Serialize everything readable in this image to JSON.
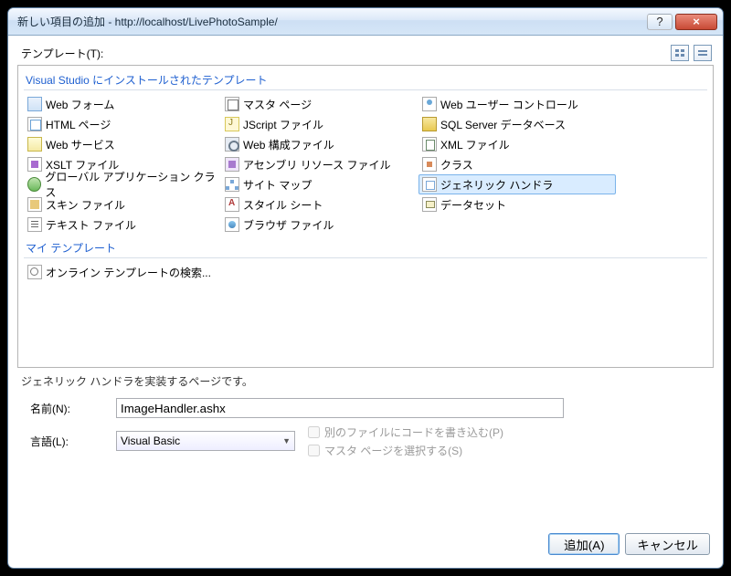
{
  "window": {
    "title": "新しい項目の追加 - http://localhost/LivePhotoSample/"
  },
  "templatesLabel": "テンプレート(T):",
  "groups": {
    "installed": "Visual Studio にインストールされたテンプレート",
    "my": "マイ テンプレート"
  },
  "items": {
    "c1": [
      {
        "name": "web-form",
        "label": "Web フォーム",
        "icon": "ic-web"
      },
      {
        "name": "html-page",
        "label": "HTML ページ",
        "icon": "ic-html"
      },
      {
        "name": "web-service",
        "label": "Web サービス",
        "icon": "ic-asmx"
      },
      {
        "name": "xslt-file",
        "label": "XSLT ファイル",
        "icon": "ic-xslt"
      },
      {
        "name": "global-app-class",
        "label": "グローバル アプリケーション クラス",
        "icon": "ic-globe"
      },
      {
        "name": "skin-file",
        "label": "スキン ファイル",
        "icon": "ic-skin"
      },
      {
        "name": "text-file",
        "label": "テキスト ファイル",
        "icon": "ic-text"
      }
    ],
    "c2": [
      {
        "name": "master-page",
        "label": "マスタ ページ",
        "icon": "ic-master"
      },
      {
        "name": "jscript-file",
        "label": "JScript ファイル",
        "icon": "ic-js"
      },
      {
        "name": "web-config-file",
        "label": "Web 構成ファイル",
        "icon": "ic-gear"
      },
      {
        "name": "assembly-resource-file",
        "label": "アセンブリ リソース ファイル",
        "icon": "ic-asm"
      },
      {
        "name": "site-map",
        "label": "サイト マップ",
        "icon": "ic-sitemap"
      },
      {
        "name": "style-sheet",
        "label": "スタイル シート",
        "icon": "ic-css"
      },
      {
        "name": "browser-file",
        "label": "ブラウザ ファイル",
        "icon": "ic-browser"
      }
    ],
    "c3": [
      {
        "name": "web-user-control",
        "label": "Web ユーザー コントロール",
        "icon": "ic-user"
      },
      {
        "name": "sql-server-database",
        "label": "SQL Server データベース",
        "icon": "ic-db"
      },
      {
        "name": "xml-file",
        "label": "XML ファイル",
        "icon": "ic-xml"
      },
      {
        "name": "class",
        "label": "クラス",
        "icon": "ic-class"
      },
      {
        "name": "generic-handler",
        "label": "ジェネリック ハンドラ",
        "icon": "ic-handler",
        "selected": true
      },
      {
        "name": "dataset",
        "label": "データセット",
        "icon": "ic-dataset"
      }
    ],
    "my": [
      {
        "name": "search-online-templates",
        "label": "オンライン テンプレートの検索...",
        "icon": "ic-search"
      }
    ]
  },
  "description": "ジェネリック ハンドラを実装するページです。",
  "nameField": {
    "label": "名前(N):",
    "value": "ImageHandler.ashx"
  },
  "languageField": {
    "label": "言語(L):",
    "value": "Visual Basic"
  },
  "checkboxes": {
    "codeInSeparateFile": "別のファイルにコードを書き込む(P)",
    "selectMasterPage": "マスタ ページを選択する(S)"
  },
  "buttons": {
    "add": "追加(A)",
    "cancel": "キャンセル"
  }
}
